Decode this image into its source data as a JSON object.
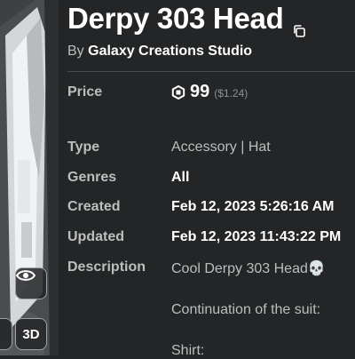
{
  "thumbnail": {
    "controls": {
      "view_3d_label": "3D"
    }
  },
  "item": {
    "title": "Derpy 303 Head",
    "by_prefix": "By",
    "creator": "Galaxy Creations Studio"
  },
  "details": {
    "price": {
      "label": "Price",
      "amount": "99",
      "usd": "($1.24)"
    },
    "type": {
      "label": "Type",
      "value": "Accessory | Hat"
    },
    "genres": {
      "label": "Genres",
      "value": "All"
    },
    "created": {
      "label": "Created",
      "value": "Feb 12, 2023 5:26:16 AM"
    },
    "updated": {
      "label": "Updated",
      "value": "Feb 12, 2023 11:43:22 PM"
    },
    "description": {
      "label": "Description",
      "lines": [
        "Cool Derpy 303 Head💀",
        "Continuation of the suit:",
        "Shirt:"
      ]
    }
  },
  "colors": {
    "background": "#232527",
    "label": "#bdbebe",
    "value": "#ffffff"
  }
}
